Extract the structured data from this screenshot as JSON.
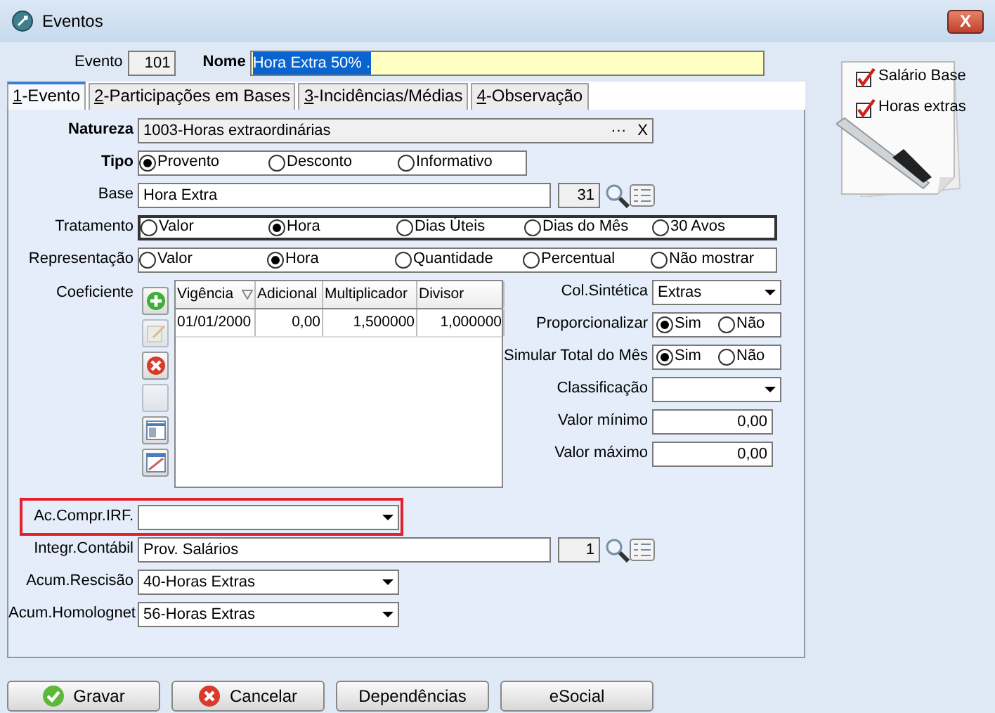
{
  "window": {
    "title": "Eventos",
    "close": "X"
  },
  "header": {
    "evento_label": "Evento",
    "evento": "101",
    "nome_label": "Nome",
    "nome": "Hora Extra 50% ."
  },
  "tabs": [
    {
      "hotkey": "1",
      "label": "-Evento",
      "selected": true
    },
    {
      "hotkey": "2",
      "label": "-Participações em Bases",
      "selected": false
    },
    {
      "hotkey": "3",
      "label": "-Incidências/Médias",
      "selected": false
    },
    {
      "hotkey": "4",
      "label": "-Observação",
      "selected": false
    }
  ],
  "top_fields": [
    {
      "kind": "picker",
      "label": "Natureza",
      "bold": true,
      "value": "1003-Horas extraordinárias",
      "browse": "···",
      "clear": "X"
    },
    {
      "kind": "radios",
      "label": "Tipo",
      "bold": true,
      "focused": false,
      "options": [
        {
          "label": "Provento",
          "selected": true
        },
        {
          "label": "Desconto",
          "selected": false
        },
        {
          "label": "Informativo",
          "selected": false
        }
      ]
    },
    {
      "kind": "lookup",
      "label": "Base",
      "bold": false,
      "value": "Hora Extra",
      "code": "31"
    },
    {
      "kind": "radios",
      "label": "Tratamento",
      "bold": false,
      "focused": true,
      "options": [
        {
          "label": "Valor",
          "selected": false
        },
        {
          "label": "Hora",
          "selected": true
        },
        {
          "label": "Dias Úteis",
          "selected": false
        },
        {
          "label": "Dias do Mês",
          "selected": false
        },
        {
          "label": "30 Avos",
          "selected": false
        }
      ]
    },
    {
      "kind": "radios",
      "label": "Representação",
      "bold": false,
      "focused": false,
      "options": [
        {
          "label": "Valor",
          "selected": false
        },
        {
          "label": "Hora",
          "selected": true
        },
        {
          "label": "Quantidade",
          "selected": false
        },
        {
          "label": "Percentual",
          "selected": false
        },
        {
          "label": "Não mostrar",
          "selected": false
        }
      ]
    }
  ],
  "coeficiente": {
    "label": "Coeficiente",
    "tools": [
      {
        "kind": "add",
        "disabled": false
      },
      {
        "kind": "edit",
        "disabled": true
      },
      {
        "kind": "delete",
        "disabled": false
      },
      {
        "kind": "blank",
        "disabled": true
      },
      {
        "kind": "columns",
        "disabled": false
      },
      {
        "kind": "form",
        "disabled": false
      }
    ],
    "table": {
      "columns": [
        {
          "label": "Vigência",
          "sorted": true
        },
        {
          "label": "Adicional",
          "sorted": false
        },
        {
          "label": "Multiplicador",
          "sorted": false
        },
        {
          "label": "Divisor",
          "sorted": false
        }
      ],
      "rows": [
        [
          "01/01/2000",
          "0,00",
          "1,500000",
          "1,000000"
        ]
      ]
    }
  },
  "side_fields": [
    {
      "kind": "select",
      "label": "Col.Sintética",
      "value": "Extras"
    },
    {
      "kind": "radios",
      "label": "Proporcionalizar",
      "options": [
        {
          "label": "Sim",
          "selected": true
        },
        {
          "label": "Não",
          "selected": false
        }
      ]
    },
    {
      "kind": "radios",
      "label": "Simular Total do Mês",
      "options": [
        {
          "label": "Sim",
          "selected": true
        },
        {
          "label": "Não",
          "selected": false
        }
      ]
    },
    {
      "kind": "select",
      "label": "Classificação"
    },
    {
      "kind": "number",
      "label": "Valor mínimo",
      "value": "0,00"
    },
    {
      "kind": "number",
      "label": "Valor máximo",
      "value": "0,00"
    }
  ],
  "bottom_fields": [
    {
      "kind": "select",
      "label": "Ac.Compr.IRF.",
      "highlighted": true
    },
    {
      "kind": "lookup",
      "label": "Integr.Contábil",
      "value": "Prov. Salários",
      "code": "1",
      "highlighted": false
    },
    {
      "kind": "select",
      "label": "Acum.Rescisão",
      "value": "40-Horas Extras",
      "highlighted": false
    },
    {
      "kind": "select",
      "label": "Acum.Homolognet",
      "value": "56-Horas Extras",
      "highlighted": false
    }
  ],
  "buttons": [
    {
      "label": "Gravar",
      "kind": "ok"
    },
    {
      "label": "Cancelar",
      "kind": "cancel"
    },
    {
      "label": "Dependências",
      "kind": "plain"
    },
    {
      "label": "eSocial",
      "kind": "plain"
    }
  ],
  "logo": {
    "items": [
      {
        "label": "Salário Base",
        "checked": true
      },
      {
        "label": "Horas extras",
        "checked": true
      }
    ]
  }
}
